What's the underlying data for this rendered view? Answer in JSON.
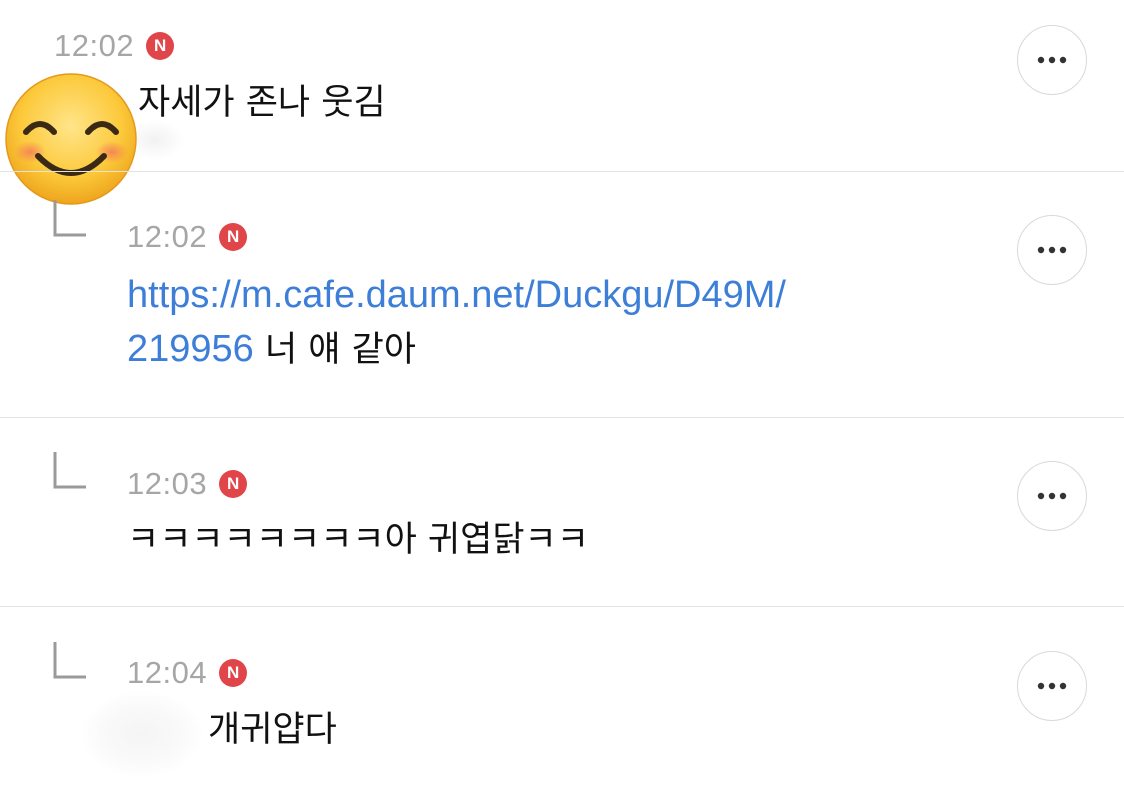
{
  "comments": [
    {
      "time": "12:02",
      "badge": "N",
      "text": "자세가 존나 웃김",
      "is_reply": false
    },
    {
      "time": "12:02",
      "badge": "N",
      "link_line1": "https://m.cafe.daum.net/Duckgu/D49M/",
      "link_line2": "219956",
      "text_suffix": " 너 얘 같아",
      "is_reply": true
    },
    {
      "time": "12:03",
      "badge": "N",
      "text": "ㅋㅋㅋㅋㅋㅋㅋㅋ아 귀엽닭ㅋㅋ",
      "is_reply": true
    },
    {
      "time": "12:04",
      "badge": "N",
      "text": "개귀얍다",
      "is_reply": true
    }
  ],
  "icons": {
    "more": "more-options-icon",
    "reply": "reply-arrow-icon",
    "avatar_cover": "smiling-face-emoji"
  },
  "colors": {
    "badge": "#e0454a",
    "link": "#3d7fd8",
    "time": "#a6a6a6",
    "divider": "#e3e3e3"
  }
}
